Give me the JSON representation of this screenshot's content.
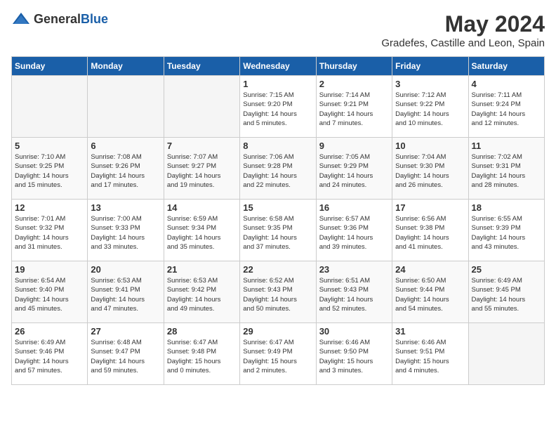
{
  "header": {
    "logo_general": "General",
    "logo_blue": "Blue",
    "month_year": "May 2024",
    "location": "Gradefes, Castille and Leon, Spain"
  },
  "days_of_week": [
    "Sunday",
    "Monday",
    "Tuesday",
    "Wednesday",
    "Thursday",
    "Friday",
    "Saturday"
  ],
  "weeks": [
    [
      {
        "day": "",
        "info": ""
      },
      {
        "day": "",
        "info": ""
      },
      {
        "day": "",
        "info": ""
      },
      {
        "day": "1",
        "info": "Sunrise: 7:15 AM\nSunset: 9:20 PM\nDaylight: 14 hours\nand 5 minutes."
      },
      {
        "day": "2",
        "info": "Sunrise: 7:14 AM\nSunset: 9:21 PM\nDaylight: 14 hours\nand 7 minutes."
      },
      {
        "day": "3",
        "info": "Sunrise: 7:12 AM\nSunset: 9:22 PM\nDaylight: 14 hours\nand 10 minutes."
      },
      {
        "day": "4",
        "info": "Sunrise: 7:11 AM\nSunset: 9:24 PM\nDaylight: 14 hours\nand 12 minutes."
      }
    ],
    [
      {
        "day": "5",
        "info": "Sunrise: 7:10 AM\nSunset: 9:25 PM\nDaylight: 14 hours\nand 15 minutes."
      },
      {
        "day": "6",
        "info": "Sunrise: 7:08 AM\nSunset: 9:26 PM\nDaylight: 14 hours\nand 17 minutes."
      },
      {
        "day": "7",
        "info": "Sunrise: 7:07 AM\nSunset: 9:27 PM\nDaylight: 14 hours\nand 19 minutes."
      },
      {
        "day": "8",
        "info": "Sunrise: 7:06 AM\nSunset: 9:28 PM\nDaylight: 14 hours\nand 22 minutes."
      },
      {
        "day": "9",
        "info": "Sunrise: 7:05 AM\nSunset: 9:29 PM\nDaylight: 14 hours\nand 24 minutes."
      },
      {
        "day": "10",
        "info": "Sunrise: 7:04 AM\nSunset: 9:30 PM\nDaylight: 14 hours\nand 26 minutes."
      },
      {
        "day": "11",
        "info": "Sunrise: 7:02 AM\nSunset: 9:31 PM\nDaylight: 14 hours\nand 28 minutes."
      }
    ],
    [
      {
        "day": "12",
        "info": "Sunrise: 7:01 AM\nSunset: 9:32 PM\nDaylight: 14 hours\nand 31 minutes."
      },
      {
        "day": "13",
        "info": "Sunrise: 7:00 AM\nSunset: 9:33 PM\nDaylight: 14 hours\nand 33 minutes."
      },
      {
        "day": "14",
        "info": "Sunrise: 6:59 AM\nSunset: 9:34 PM\nDaylight: 14 hours\nand 35 minutes."
      },
      {
        "day": "15",
        "info": "Sunrise: 6:58 AM\nSunset: 9:35 PM\nDaylight: 14 hours\nand 37 minutes."
      },
      {
        "day": "16",
        "info": "Sunrise: 6:57 AM\nSunset: 9:36 PM\nDaylight: 14 hours\nand 39 minutes."
      },
      {
        "day": "17",
        "info": "Sunrise: 6:56 AM\nSunset: 9:38 PM\nDaylight: 14 hours\nand 41 minutes."
      },
      {
        "day": "18",
        "info": "Sunrise: 6:55 AM\nSunset: 9:39 PM\nDaylight: 14 hours\nand 43 minutes."
      }
    ],
    [
      {
        "day": "19",
        "info": "Sunrise: 6:54 AM\nSunset: 9:40 PM\nDaylight: 14 hours\nand 45 minutes."
      },
      {
        "day": "20",
        "info": "Sunrise: 6:53 AM\nSunset: 9:41 PM\nDaylight: 14 hours\nand 47 minutes."
      },
      {
        "day": "21",
        "info": "Sunrise: 6:53 AM\nSunset: 9:42 PM\nDaylight: 14 hours\nand 49 minutes."
      },
      {
        "day": "22",
        "info": "Sunrise: 6:52 AM\nSunset: 9:43 PM\nDaylight: 14 hours\nand 50 minutes."
      },
      {
        "day": "23",
        "info": "Sunrise: 6:51 AM\nSunset: 9:43 PM\nDaylight: 14 hours\nand 52 minutes."
      },
      {
        "day": "24",
        "info": "Sunrise: 6:50 AM\nSunset: 9:44 PM\nDaylight: 14 hours\nand 54 minutes."
      },
      {
        "day": "25",
        "info": "Sunrise: 6:49 AM\nSunset: 9:45 PM\nDaylight: 14 hours\nand 55 minutes."
      }
    ],
    [
      {
        "day": "26",
        "info": "Sunrise: 6:49 AM\nSunset: 9:46 PM\nDaylight: 14 hours\nand 57 minutes."
      },
      {
        "day": "27",
        "info": "Sunrise: 6:48 AM\nSunset: 9:47 PM\nDaylight: 14 hours\nand 59 minutes."
      },
      {
        "day": "28",
        "info": "Sunrise: 6:47 AM\nSunset: 9:48 PM\nDaylight: 15 hours\nand 0 minutes."
      },
      {
        "day": "29",
        "info": "Sunrise: 6:47 AM\nSunset: 9:49 PM\nDaylight: 15 hours\nand 2 minutes."
      },
      {
        "day": "30",
        "info": "Sunrise: 6:46 AM\nSunset: 9:50 PM\nDaylight: 15 hours\nand 3 minutes."
      },
      {
        "day": "31",
        "info": "Sunrise: 6:46 AM\nSunset: 9:51 PM\nDaylight: 15 hours\nand 4 minutes."
      },
      {
        "day": "",
        "info": ""
      }
    ]
  ]
}
